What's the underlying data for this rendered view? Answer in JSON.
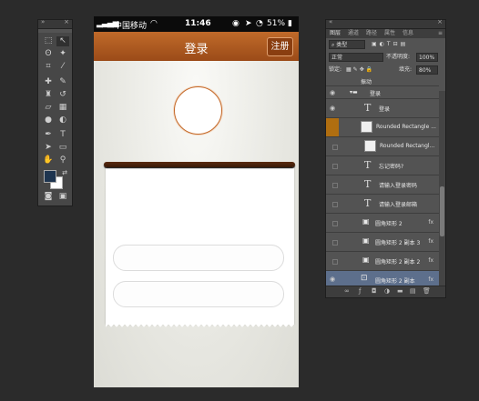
{
  "phone": {
    "carrier": "中国移动",
    "time": "11:46",
    "battery": "51%",
    "nav_title": "登录",
    "register_label": "注册"
  },
  "layers": {
    "tabs": [
      "图层",
      "通道",
      "路径",
      "属性",
      "信息"
    ],
    "filter_kind": "类型",
    "blend_mode": "正常",
    "opacity_label": "不透明度:",
    "opacity_value": "100%",
    "lock_label": "锁定:",
    "fill_label": "填充:",
    "fill_value": "80%",
    "top_partial": "振动",
    "rows": [
      {
        "name": "登录",
        "kind": "group"
      },
      {
        "name": "登录",
        "kind": "text"
      },
      {
        "name": "Rounded Rectangle ...",
        "kind": "smart"
      },
      {
        "name": "Rounded Rectangl...",
        "kind": "smart"
      },
      {
        "name": "忘记密码?",
        "kind": "text"
      },
      {
        "name": "请输入登录密码",
        "kind": "text"
      },
      {
        "name": "请输入登录邮箱",
        "kind": "text"
      },
      {
        "name": "圆角矩形 2",
        "kind": "shape",
        "fx": "fx"
      },
      {
        "name": "圆角矩形 2 副本 3",
        "kind": "shape",
        "fx": "fx"
      },
      {
        "name": "圆角矩形 2 副本 2",
        "kind": "shape",
        "fx": "fx"
      },
      {
        "name": "圆角矩形 2 副本",
        "kind": "shape",
        "fx": "fx"
      }
    ]
  },
  "colors": {
    "nav_brown": "#b05c22",
    "canvas_bg": "#2b2b2b",
    "selected_layer": "#5d6f8c"
  }
}
